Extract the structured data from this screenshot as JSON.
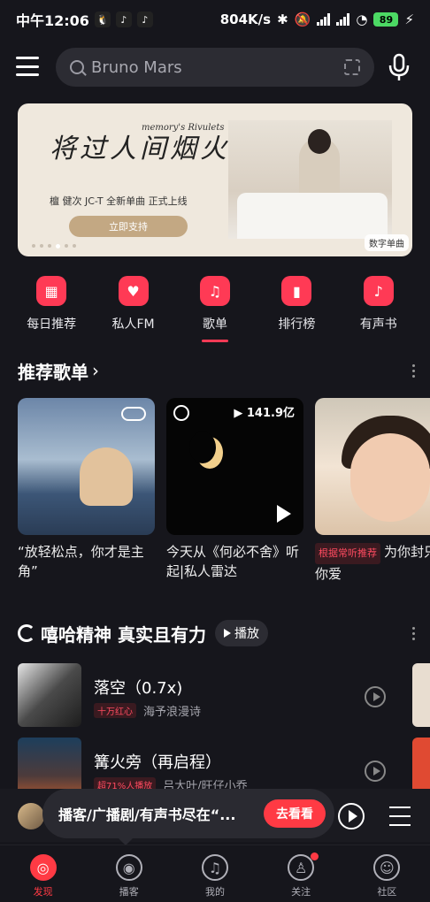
{
  "status_bar": {
    "time": "中午12:06",
    "network_speed": "804K/s",
    "battery": "89"
  },
  "search": {
    "placeholder": "Bruno Mars"
  },
  "banner": {
    "title": "将过人间烟火",
    "subtitle": "memory's Rivulets",
    "credit": "檀 健次 JC-T  全新单曲 正式上线",
    "cta": "立即支持",
    "tag": "数字单曲"
  },
  "quicknav": {
    "items": [
      {
        "label": "每日推荐",
        "icon": "calendar-icon"
      },
      {
        "label": "私人FM",
        "icon": "radio-icon"
      },
      {
        "label": "歌单",
        "icon": "music-note-icon"
      },
      {
        "label": "排行榜",
        "icon": "chart-bars-icon"
      },
      {
        "label": "有声书",
        "icon": "audiobook-icon"
      }
    ]
  },
  "recommended": {
    "title": "推荐歌单",
    "cards": [
      {
        "text": "“放轻松点，你才是主角”"
      },
      {
        "play_count": "141.9亿",
        "text": "今天从《何必不舍》听起|私人雷达"
      },
      {
        "tag": "根据常听推荐",
        "text": "为你封只唱你爱"
      }
    ]
  },
  "section2": {
    "title": "嘻哈精神 真实且有力",
    "play_label": "播放",
    "songs": [
      {
        "title": "落空（0.7x)",
        "badge": "十万红心",
        "artist": "海予浪漫诗"
      },
      {
        "title": "篝火旁（再启程）",
        "badge": "超71%人播放",
        "artist": "吕大叶/旺仔小乔"
      }
    ]
  },
  "mini_player": {
    "tooltip": "播客/广播剧/有声书尽在“...",
    "tooltip_button": "去看看"
  },
  "tabs": [
    {
      "label": "发现"
    },
    {
      "label": "播客"
    },
    {
      "label": "我的"
    },
    {
      "label": "关注"
    },
    {
      "label": "社区"
    }
  ],
  "colors": {
    "accent": "#ff3a44",
    "background": "#16161c"
  }
}
